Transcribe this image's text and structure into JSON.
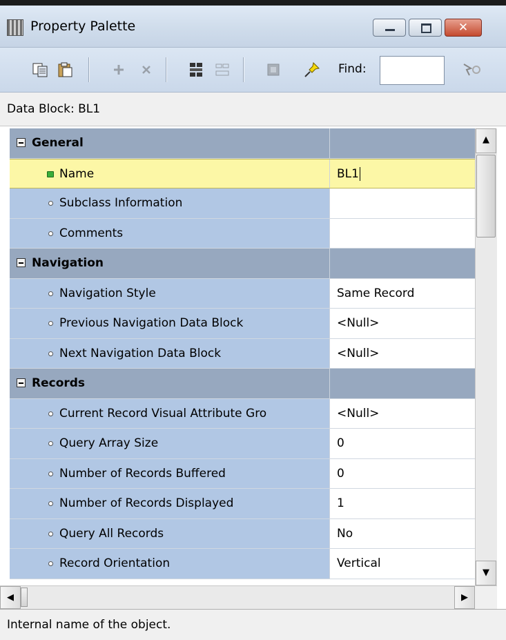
{
  "window": {
    "title": "Property Palette",
    "close_glyph": "✕"
  },
  "toolbar": {
    "find_label": "Find:",
    "find_value": "",
    "icons": [
      "copy-properties-icon",
      "paste-properties-icon",
      "add-property-icon",
      "delete-property-icon",
      "union-icon",
      "intersection-icon",
      "inherit-icon",
      "freeze-pin-icon",
      "find-icon"
    ]
  },
  "context": {
    "text": "Data Block: BL1"
  },
  "properties": {
    "general": {
      "title": "General",
      "name_label": "Name",
      "name_value": "BL1",
      "subclass_label": "Subclass Information",
      "subclass_value": "",
      "comments_label": "Comments",
      "comments_value": ""
    },
    "navigation": {
      "title": "Navigation",
      "style_label": "Navigation Style",
      "style_value": "Same Record",
      "prev_label": "Previous Navigation Data Block",
      "prev_value": "<Null>",
      "next_label": "Next Navigation Data Block",
      "next_value": "<Null>"
    },
    "records": {
      "title": "Records",
      "visual_attr_label": "Current Record Visual Attribute Gro",
      "visual_attr_value": "<Null>",
      "array_size_label": "Query Array Size",
      "array_size_value": "0",
      "buffered_label": "Number of Records Buffered",
      "buffered_value": "0",
      "displayed_label": "Number of Records Displayed",
      "displayed_value": "1",
      "query_all_label": "Query All Records",
      "query_all_value": "No",
      "orientation_label": "Record Orientation",
      "orientation_value": "Vertical"
    }
  },
  "status": {
    "text": "Internal name of the object."
  },
  "colors": {
    "group_row": "#97a8bf",
    "property_name": "#b1c7e4",
    "selected_row": "#fcf7a6"
  }
}
